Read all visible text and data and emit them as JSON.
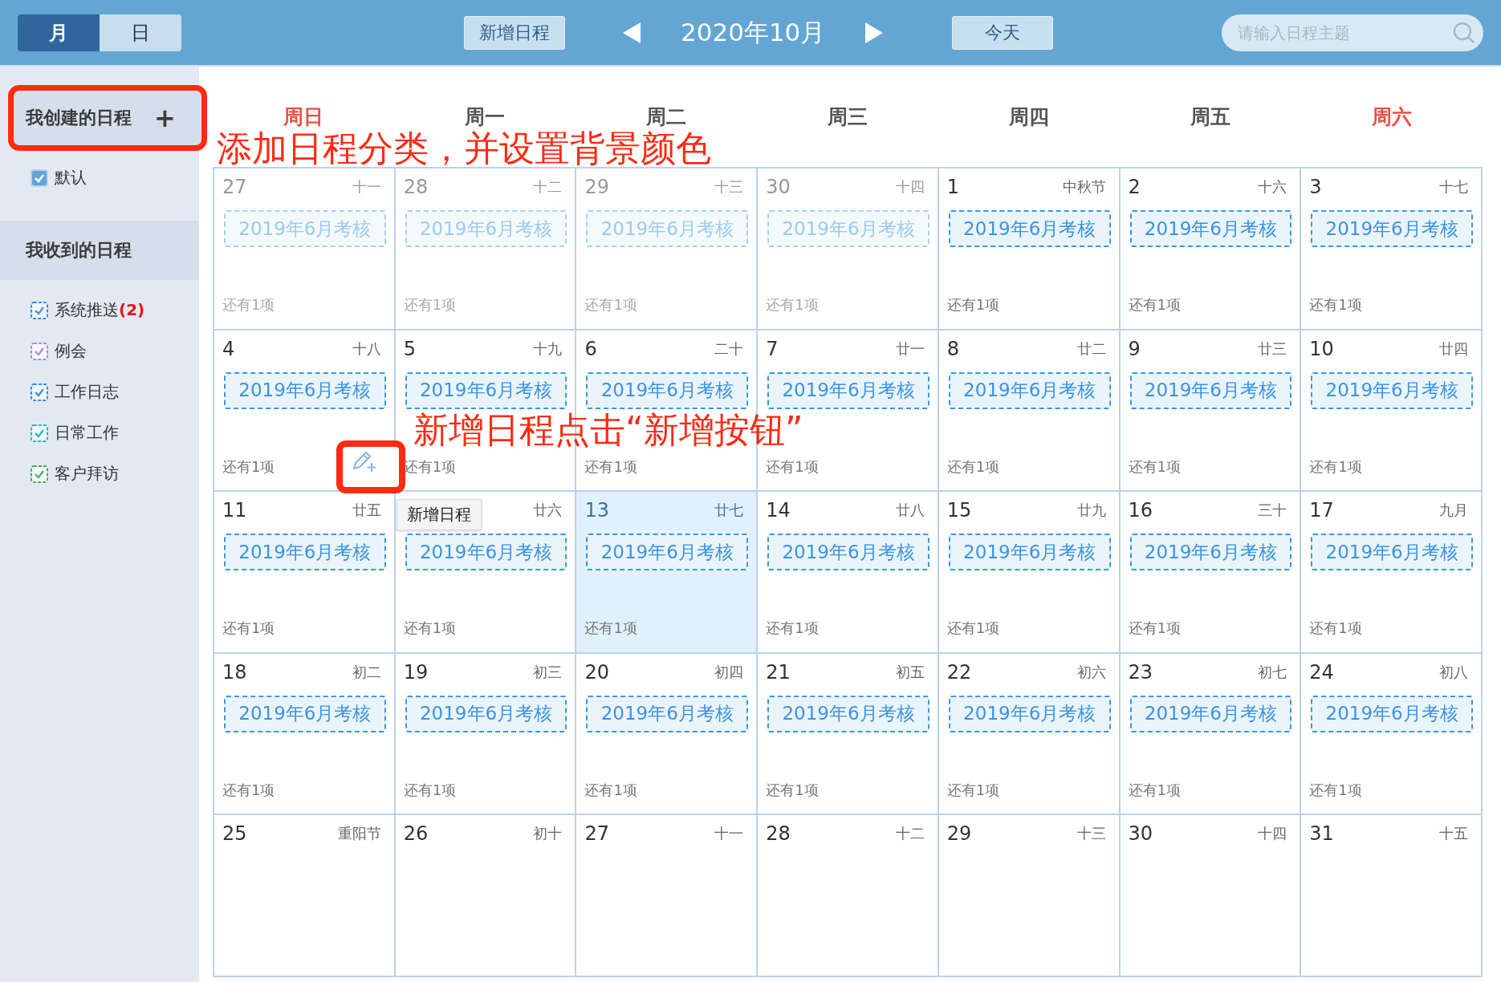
{
  "toolbar": {
    "view_tabs": [
      {
        "label": "月",
        "selected": true
      },
      {
        "label": "日",
        "selected": false
      }
    ],
    "add_button": "新增日程",
    "title": "2020年10月",
    "today_button": "今天",
    "search": {
      "placeholder": "请输入日程主题"
    }
  },
  "sidebar": {
    "sections": [
      {
        "title": "我创建的日程",
        "add": "+",
        "highlighted": true,
        "items": [
          {
            "label": "默认",
            "kind": "solid",
            "checked": true,
            "color": "#5fa3d8"
          }
        ]
      },
      {
        "title": "我收到的日程",
        "highlighted": false,
        "items": [
          {
            "label": "系统推送",
            "count": "(2)",
            "kind": "dashed",
            "checked": true,
            "color": "#3b8fe8"
          },
          {
            "label": "例会",
            "kind": "dashed",
            "checked": true,
            "color": "#b08ad8"
          },
          {
            "label": "工作日志",
            "kind": "dashed",
            "checked": true,
            "color": "#3b8fe8"
          },
          {
            "label": "日常工作",
            "kind": "dashed",
            "checked": true,
            "color": "#2bb5c4"
          },
          {
            "label": "客户拜访",
            "kind": "dashed",
            "checked": true,
            "color": "#4caf50"
          }
        ]
      }
    ]
  },
  "calendar": {
    "weekdays": [
      {
        "label": "周日",
        "weekend": true
      },
      {
        "label": "周一",
        "weekend": false
      },
      {
        "label": "周二",
        "weekend": false
      },
      {
        "label": "周三",
        "weekend": false
      },
      {
        "label": "周四",
        "weekend": false
      },
      {
        "label": "周五",
        "weekend": false
      },
      {
        "label": "周六",
        "weekend": true
      }
    ],
    "weeks": [
      [
        {
          "day": "27",
          "lunar": "十一",
          "other_month": true,
          "today": false,
          "events": [
            "2019年6月考核"
          ],
          "more": "还有1项"
        },
        {
          "day": "28",
          "lunar": "十二",
          "other_month": true,
          "today": false,
          "events": [
            "2019年6月考核"
          ],
          "more": "还有1项"
        },
        {
          "day": "29",
          "lunar": "十三",
          "other_month": true,
          "today": false,
          "events": [
            "2019年6月考核"
          ],
          "more": "还有1项"
        },
        {
          "day": "30",
          "lunar": "十四",
          "other_month": true,
          "today": false,
          "events": [
            "2019年6月考核"
          ],
          "more": "还有1项"
        },
        {
          "day": "1",
          "lunar": "中秋节",
          "other_month": false,
          "today": false,
          "events": [
            "2019年6月考核"
          ],
          "more": "还有1项"
        },
        {
          "day": "2",
          "lunar": "十六",
          "other_month": false,
          "today": false,
          "events": [
            "2019年6月考核"
          ],
          "more": "还有1项"
        },
        {
          "day": "3",
          "lunar": "十七",
          "other_month": false,
          "today": false,
          "events": [
            "2019年6月考核"
          ],
          "more": "还有1项"
        }
      ],
      [
        {
          "day": "4",
          "lunar": "十八",
          "other_month": false,
          "today": false,
          "events": [
            "2019年6月考核"
          ],
          "more": "还有1项"
        },
        {
          "day": "5",
          "lunar": "十九",
          "other_month": false,
          "today": false,
          "events": [
            "2019年6月考核"
          ],
          "more": "还有1项"
        },
        {
          "day": "6",
          "lunar": "二十",
          "other_month": false,
          "today": false,
          "events": [
            "2019年6月考核"
          ],
          "more": "还有1项"
        },
        {
          "day": "7",
          "lunar": "廿一",
          "other_month": false,
          "today": false,
          "events": [
            "2019年6月考核"
          ],
          "more": "还有1项"
        },
        {
          "day": "8",
          "lunar": "廿二",
          "other_month": false,
          "today": false,
          "events": [
            "2019年6月考核"
          ],
          "more": "还有1项"
        },
        {
          "day": "9",
          "lunar": "廿三",
          "other_month": false,
          "today": false,
          "events": [
            "2019年6月考核"
          ],
          "more": "还有1项"
        },
        {
          "day": "10",
          "lunar": "廿四",
          "other_month": false,
          "today": false,
          "events": [
            "2019年6月考核"
          ],
          "more": "还有1项"
        }
      ],
      [
        {
          "day": "11",
          "lunar": "廿五",
          "other_month": false,
          "today": false,
          "events": [
            "2019年6月考核"
          ],
          "more": "还有1项"
        },
        {
          "lunar": "廿六",
          "other_month": false,
          "today": false,
          "events": [
            "2019年6月考核"
          ],
          "more": "还有1项"
        },
        {
          "day": "13",
          "lunar": "廿七",
          "other_month": false,
          "today": true,
          "events": [
            "2019年6月考核"
          ],
          "more": "还有1项"
        },
        {
          "day": "14",
          "lunar": "廿八",
          "other_month": false,
          "today": false,
          "events": [
            "2019年6月考核"
          ],
          "more": "还有1项"
        },
        {
          "day": "15",
          "lunar": "廿九",
          "other_month": false,
          "today": false,
          "events": [
            "2019年6月考核"
          ],
          "more": "还有1项"
        },
        {
          "day": "16",
          "lunar": "三十",
          "other_month": false,
          "today": false,
          "events": [
            "2019年6月考核"
          ],
          "more": "还有1项"
        },
        {
          "day": "17",
          "lunar": "九月",
          "other_month": false,
          "today": false,
          "events": [
            "2019年6月考核"
          ],
          "more": "还有1项"
        }
      ],
      [
        {
          "day": "18",
          "lunar": "初二",
          "other_month": false,
          "today": false,
          "events": [
            "2019年6月考核"
          ],
          "more": "还有1项"
        },
        {
          "day": "19",
          "lunar": "初三",
          "other_month": false,
          "today": false,
          "events": [
            "2019年6月考核"
          ],
          "more": "还有1项"
        },
        {
          "day": "20",
          "lunar": "初四",
          "other_month": false,
          "today": false,
          "events": [
            "2019年6月考核"
          ],
          "more": "还有1项"
        },
        {
          "day": "21",
          "lunar": "初五",
          "other_month": false,
          "today": false,
          "events": [
            "2019年6月考核"
          ],
          "more": "还有1项"
        },
        {
          "day": "22",
          "lunar": "初六",
          "other_month": false,
          "today": false,
          "events": [
            "2019年6月考核"
          ],
          "more": "还有1项"
        },
        {
          "day": "23",
          "lunar": "初七",
          "other_month": false,
          "today": false,
          "events": [
            "2019年6月考核"
          ],
          "more": "还有1项"
        },
        {
          "day": "24",
          "lunar": "初八",
          "other_month": false,
          "today": false,
          "events": [
            "2019年6月考核"
          ],
          "more": "还有1项"
        }
      ],
      [
        {
          "day": "25",
          "lunar": "重阳节",
          "other_month": false,
          "today": false
        },
        {
          "day": "26",
          "lunar": "初十",
          "other_month": false,
          "today": false
        },
        {
          "day": "27",
          "lunar": "十一",
          "other_month": false,
          "today": false
        },
        {
          "day": "28",
          "lunar": "十二",
          "other_month": false,
          "today": false
        },
        {
          "day": "29",
          "lunar": "十三",
          "other_month": false,
          "today": false
        },
        {
          "day": "30",
          "lunar": "十四",
          "other_month": false,
          "today": false
        },
        {
          "day": "31",
          "lunar": "十五",
          "other_month": false,
          "today": false
        }
      ]
    ],
    "hover_tool": {
      "tooltip": "新增日程"
    }
  },
  "annotations": [
    {
      "kind": "heading",
      "text": "添加日程分类，并设置背景颜色"
    },
    {
      "kind": "button_hint",
      "text": "新增日程点击“新增按钮”"
    }
  ]
}
